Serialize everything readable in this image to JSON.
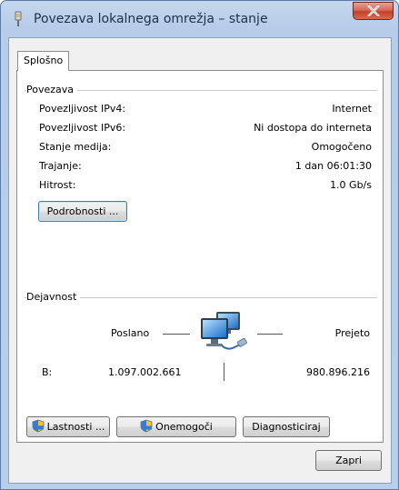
{
  "window": {
    "title": "Povezava lokalnega omrežja – stanje",
    "close_glyph": "X"
  },
  "tabs": [
    {
      "label": "Splošno",
      "selected": true
    }
  ],
  "connection": {
    "group_label": "Povezava",
    "rows": [
      {
        "label": "Povezljivost IPv4:",
        "value": "Internet"
      },
      {
        "label": "Povezljivost IPv6:",
        "value": "Ni dostopa do interneta"
      },
      {
        "label": "Stanje medija:",
        "value": "Omogočeno"
      },
      {
        "label": "Trajanje:",
        "value": "1 dan 06:01:30"
      },
      {
        "label": "Hitrost:",
        "value": "1.0 Gb/s"
      }
    ],
    "details_button": "Podrobnosti ..."
  },
  "activity": {
    "group_label": "Dejavnost",
    "sent_label": "Poslano",
    "received_label": "Prejeto",
    "bytes_label": "B:",
    "sent_bytes": "1.097.002.661",
    "received_bytes": "980.896.216",
    "icon": "network-computers-icon"
  },
  "actions": {
    "properties_button": "Lastnosti ...",
    "disable_button": "Onemogoči",
    "diagnose_button": "Diagnosticiraj",
    "close_button": "Zapri"
  },
  "colors": {
    "frame": "#b9cee9",
    "close_button": "#c2402c",
    "panel": "#ffffff",
    "dialog": "#f0f0f0"
  }
}
